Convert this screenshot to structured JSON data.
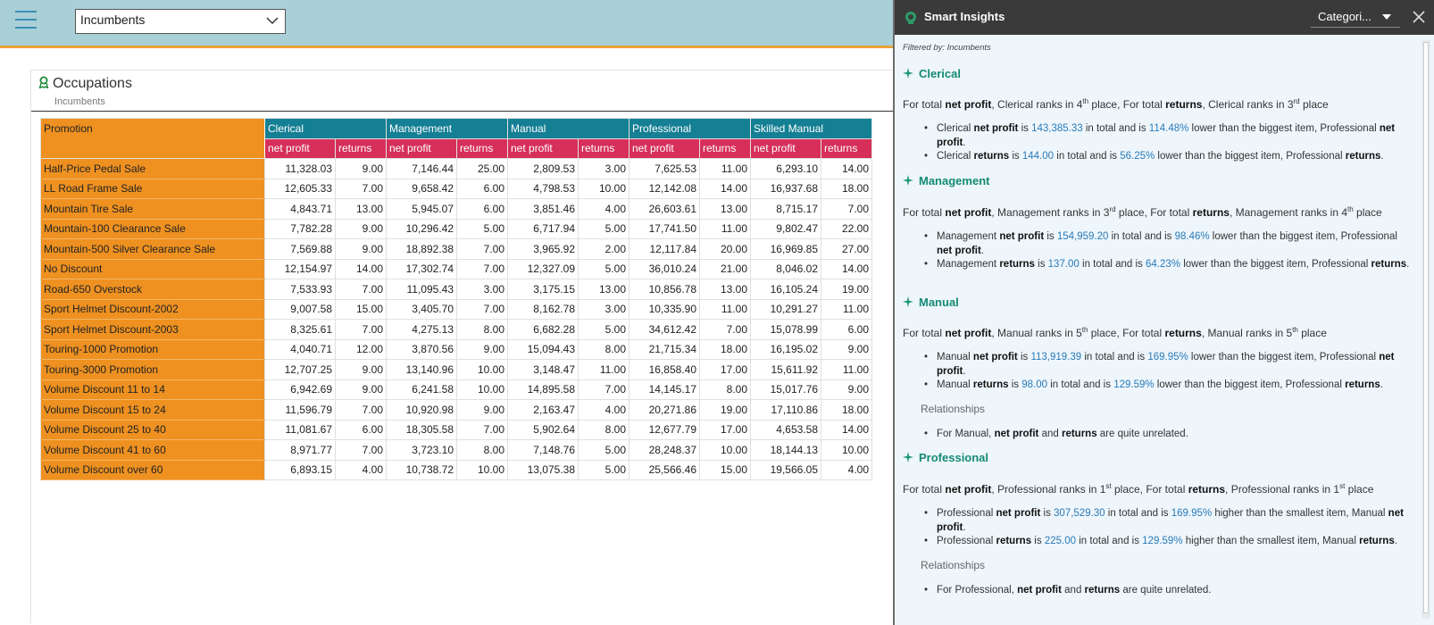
{
  "topbar": {
    "dropdown_value": "Incumbents"
  },
  "report": {
    "title": "Occupations",
    "subtitle": "Incumbents",
    "corner_header": "Promotion",
    "groups": [
      "Clerical",
      "Management",
      "Manual",
      "Professional",
      "Skilled Manual"
    ],
    "sub_headers": [
      "net profit",
      "returns"
    ],
    "rows": [
      {
        "label": "Half-Price Pedal Sale",
        "values": [
          "11,328.03",
          "9.00",
          "7,146.44",
          "25.00",
          "2,809.53",
          "3.00",
          "7,625.53",
          "11.00",
          "6,293.10",
          "14.00"
        ]
      },
      {
        "label": "LL Road Frame Sale",
        "values": [
          "12,605.33",
          "7.00",
          "9,658.42",
          "6.00",
          "4,798.53",
          "10.00",
          "12,142.08",
          "14.00",
          "16,937.68",
          "18.00"
        ]
      },
      {
        "label": "Mountain Tire Sale",
        "values": [
          "4,843.71",
          "13.00",
          "5,945.07",
          "6.00",
          "3,851.46",
          "4.00",
          "26,603.61",
          "13.00",
          "8,715.17",
          "7.00"
        ]
      },
      {
        "label": "Mountain-100 Clearance Sale",
        "values": [
          "7,782.28",
          "9.00",
          "10,296.42",
          "5.00",
          "6,717.94",
          "5.00",
          "17,741.50",
          "11.00",
          "9,802.47",
          "22.00"
        ]
      },
      {
        "label": "Mountain-500 Silver Clearance Sale",
        "values": [
          "7,569.88",
          "9.00",
          "18,892.38",
          "7.00",
          "3,965.92",
          "2.00",
          "12,117.84",
          "20.00",
          "16,969.85",
          "27.00"
        ]
      },
      {
        "label": "No Discount",
        "values": [
          "12,154.97",
          "14.00",
          "17,302.74",
          "7.00",
          "12,327.09",
          "5.00",
          "36,010.24",
          "21.00",
          "8,046.02",
          "14.00"
        ]
      },
      {
        "label": "Road-650 Overstock",
        "values": [
          "7,533.93",
          "7.00",
          "11,095.43",
          "3.00",
          "3,175.15",
          "13.00",
          "10,856.78",
          "13.00",
          "16,105.24",
          "19.00"
        ]
      },
      {
        "label": "Sport Helmet Discount-2002",
        "values": [
          "9,007.58",
          "15.00",
          "3,405.70",
          "7.00",
          "8,162.78",
          "3.00",
          "10,335.90",
          "11.00",
          "10,291.27",
          "11.00"
        ]
      },
      {
        "label": "Sport Helmet Discount-2003",
        "values": [
          "8,325.61",
          "7.00",
          "4,275.13",
          "8.00",
          "6,682.28",
          "5.00",
          "34,612.42",
          "7.00",
          "15,078.99",
          "6.00"
        ]
      },
      {
        "label": "Touring-1000 Promotion",
        "values": [
          "4,040.71",
          "12.00",
          "3,870.56",
          "9.00",
          "15,094.43",
          "8.00",
          "21,715.34",
          "18.00",
          "16,195.02",
          "9.00"
        ]
      },
      {
        "label": "Touring-3000 Promotion",
        "values": [
          "12,707.25",
          "9.00",
          "13,140.96",
          "10.00",
          "3,148.47",
          "11.00",
          "16,858.40",
          "17.00",
          "15,611.92",
          "11.00"
        ]
      },
      {
        "label": "Volume Discount 11 to 14",
        "values": [
          "6,942.69",
          "9.00",
          "6,241.58",
          "10.00",
          "14,895.58",
          "7.00",
          "14,145.17",
          "8.00",
          "15,017.76",
          "9.00"
        ]
      },
      {
        "label": "Volume Discount 15 to 24",
        "values": [
          "11,596.79",
          "7.00",
          "10,920.98",
          "9.00",
          "2,163.47",
          "4.00",
          "20,271.86",
          "19.00",
          "17,110.86",
          "18.00"
        ]
      },
      {
        "label": "Volume Discount 25 to 40",
        "values": [
          "11,081.67",
          "6.00",
          "18,305.58",
          "7.00",
          "5,902.64",
          "8.00",
          "12,677.79",
          "17.00",
          "4,653.58",
          "14.00"
        ]
      },
      {
        "label": "Volume Discount 41 to 60",
        "values": [
          "8,971.77",
          "7.00",
          "3,723.10",
          "8.00",
          "7,148.76",
          "5.00",
          "28,248.37",
          "10.00",
          "18,144.13",
          "10.00"
        ]
      },
      {
        "label": "Volume Discount over 60",
        "values": [
          "6,893.15",
          "4.00",
          "10,738.72",
          "10.00",
          "13,075.38",
          "5.00",
          "25,566.46",
          "15.00",
          "19,566.05",
          "4.00"
        ]
      }
    ]
  },
  "insights": {
    "title": "Smart Insights",
    "category_select": "Categori...",
    "filtered_by": "Filtered by: Incumbents",
    "relationships_label": "Relationships",
    "sections": [
      {
        "name": "Clerical",
        "summary": {
          "p1": "For total ",
          "m1": "net profit",
          "p2": ", Clerical ranks in 4",
          "s1": "th",
          "p3": " place, For total ",
          "m2": "returns",
          "p4": ", Clerical ranks in 3",
          "s2": "rd",
          "p5": " place"
        },
        "bullets": [
          {
            "a": "Clerical ",
            "m": "net profit",
            "b": " is ",
            "v1": "143,385.33",
            "c": " in total and is ",
            "v2": "114.48%",
            "d": " lower than the biggest item, Professional ",
            "m2": "net profit",
            "e": "."
          },
          {
            "a": "Clerical ",
            "m": "returns",
            "b": " is ",
            "v1": "144.00",
            "c": " in total and is ",
            "v2": "56.25%",
            "d": " lower than the biggest item, Professional ",
            "m2": "returns",
            "e": "."
          }
        ]
      },
      {
        "name": "Management",
        "summary": {
          "p1": "For total ",
          "m1": "net profit",
          "p2": ", Management ranks in 3",
          "s1": "rd",
          "p3": " place, For total ",
          "m2": "returns",
          "p4": ", Management ranks in 4",
          "s2": "th",
          "p5": " place"
        },
        "bullets": [
          {
            "a": "Management ",
            "m": "net profit",
            "b": " is ",
            "v1": "154,959.20",
            "c": " in total and is ",
            "v2": "98.46%",
            "d": " lower than the biggest item, Professional ",
            "m2": "net profit",
            "e": "."
          },
          {
            "a": "Management ",
            "m": "returns",
            "b": " is ",
            "v1": "137.00",
            "c": " in total and is ",
            "v2": "64.23%",
            "d": " lower than the biggest item, Professional ",
            "m2": "returns",
            "e": "."
          }
        ]
      },
      {
        "name": "Manual",
        "summary": {
          "p1": "For total ",
          "m1": "net profit",
          "p2": ", Manual ranks in 5",
          "s1": "th",
          "p3": " place, For total ",
          "m2": "returns",
          "p4": ", Manual ranks in 5",
          "s2": "th",
          "p5": " place"
        },
        "bullets": [
          {
            "a": "Manual ",
            "m": "net profit",
            "b": " is ",
            "v1": "113,919.39",
            "c": " in total and is ",
            "v2": "169.95%",
            "d": " lower than the biggest item, Professional ",
            "m2": "net profit",
            "e": "."
          },
          {
            "a": "Manual ",
            "m": "returns",
            "b": " is ",
            "v1": "98.00",
            "c": " in total and is ",
            "v2": "129.59%",
            "d": " lower than the biggest item, Professional ",
            "m2": "returns",
            "e": "."
          }
        ],
        "relationship": {
          "a": "For Manual, ",
          "m1": "net profit",
          "b": " and ",
          "m2": "returns",
          "c": " are quite unrelated."
        }
      },
      {
        "name": "Professional",
        "summary": {
          "p1": "For total ",
          "m1": "net profit",
          "p2": ", Professional ranks in 1",
          "s1": "st",
          "p3": " place, For total ",
          "m2": "returns",
          "p4": ", Professional ranks in 1",
          "s2": "st",
          "p5": " place"
        },
        "bullets": [
          {
            "a": "Professional ",
            "m": "net profit",
            "b": " is ",
            "v1": "307,529.30",
            "c": " in total and is ",
            "v2": "169.95%",
            "d": " higher than the smallest item, Manual ",
            "m2": "net profit",
            "e": "."
          },
          {
            "a": "Professional ",
            "m": "returns",
            "b": " is ",
            "v1": "225.00",
            "c": " in total and is ",
            "v2": "129.59%",
            "d": " higher than the smallest item, Manual ",
            "m2": "returns",
            "e": "."
          }
        ],
        "relationship": {
          "a": "For Professional, ",
          "m1": "net profit",
          "b": " and ",
          "m2": "returns",
          "c": " are quite unrelated."
        }
      }
    ]
  }
}
